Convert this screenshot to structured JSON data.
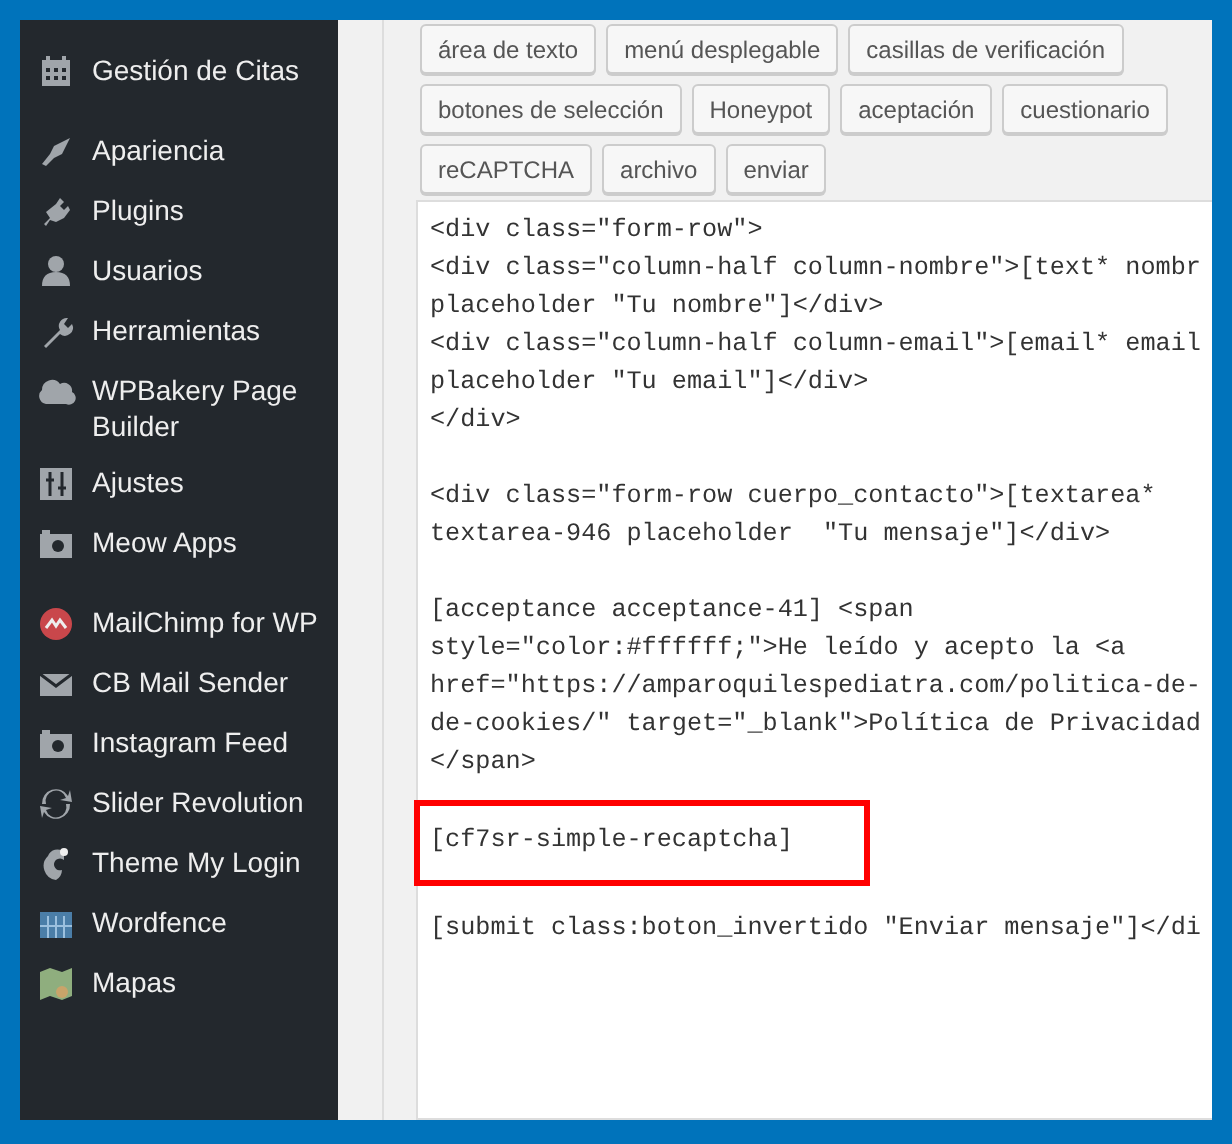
{
  "sidebar": {
    "groups": [
      {
        "items": [
          {
            "label": "Gestión de Citas"
          }
        ]
      },
      {
        "items": [
          {
            "label": "Apariencia"
          },
          {
            "label": "Plugins"
          },
          {
            "label": "Usuarios"
          },
          {
            "label": "Herramientas"
          },
          {
            "label": "WPBakery Page Builder"
          },
          {
            "label": "Ajustes"
          },
          {
            "label": "Meow Apps"
          }
        ]
      },
      {
        "items": [
          {
            "label": "MailChimp for WP"
          },
          {
            "label": "CB Mail Sender"
          },
          {
            "label": "Instagram Feed"
          },
          {
            "label": "Slider Revolution"
          },
          {
            "label": "Theme My Login"
          },
          {
            "label": "Wordfence"
          },
          {
            "label": "Mapas"
          }
        ]
      }
    ]
  },
  "tag_buttons": [
    [
      "área de texto",
      "menú desplegable",
      "casillas de verificación"
    ],
    [
      "botones de selección",
      "Honeypot",
      "aceptación",
      "cuestionario"
    ],
    [
      "reCAPTCHA",
      "archivo",
      "enviar"
    ]
  ],
  "editor": {
    "blocks": [
      {
        "highlighted": false,
        "lines": [
          "<div class=\"form-row\">",
          "<div class=\"column-half column-nombre\">[text* nombr",
          "placeholder \"Tu nombre\"]</div>",
          "<div class=\"column-half column-email\">[email* email",
          "placeholder \"Tu email\"]</div>",
          "</div>"
        ]
      },
      {
        "highlighted": false,
        "lines": [
          "<div class=\"form-row cuerpo_contacto\">[textarea*",
          "textarea-946 placeholder  \"Tu mensaje\"]</div>"
        ]
      },
      {
        "highlighted": false,
        "lines": [
          "[acceptance acceptance-41] <span",
          "style=\"color:#ffffff;\">He leído y acepto la <a",
          "href=\"https://amparoquilespediatra.com/politica-de-",
          "de-cookies/\" target=\"_blank\">Política de Privacidad",
          "</span>"
        ]
      },
      {
        "highlighted": true,
        "lines": [
          "[cf7sr-simple-recaptcha]"
        ]
      },
      {
        "highlighted": false,
        "lines": [
          "[submit class:boton_invertido \"Enviar mensaje\"]</di"
        ]
      }
    ]
  }
}
